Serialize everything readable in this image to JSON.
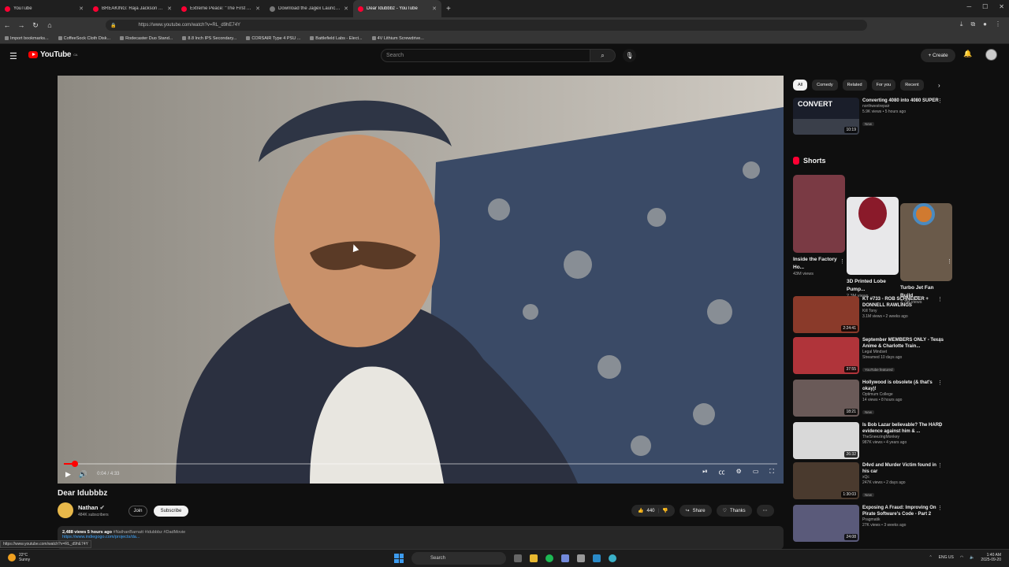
{
  "browser": {
    "tabs": [
      {
        "title": "YouTube",
        "active": false
      },
      {
        "title": "BREAKING: Raja Jackson Arrest...",
        "active": false
      },
      {
        "title": "Extreme Peace: \"The First AI\" St...",
        "active": false
      },
      {
        "title": "Download the Jagex Launcher -",
        "active": false
      },
      {
        "title": "Dear Idubbbz - YouTube",
        "active": true
      }
    ],
    "url": "https://www.youtube.com/watch?v=RL_d9hE74Y",
    "bookmarks": [
      "Import bookmarks...",
      "CoffeeSock Cloth Disk...",
      "Rodecaster Duo Stand...",
      "8.8 Inch IPS Secondary...",
      "CORSAIR Type 4 PSU ...",
      "Battlefield Labs - Elect...",
      "4V Lithium Screwdrive..."
    ]
  },
  "youtube": {
    "logo_text": "YouTube",
    "region": "CA",
    "search_placeholder": "Search",
    "create_label": "Create"
  },
  "player": {
    "time": "0:04 / 4:33",
    "progress_fraction": 0.015
  },
  "video": {
    "title": "Dear Idubbbz",
    "channel": "Nathan",
    "subscribers": "484K subscribers",
    "join_label": "Join",
    "subscribe_label": "Subscribe",
    "likes": "440",
    "share_label": "Share",
    "thanks_label": "Thanks",
    "views_time": "2,488 views  5 hours ago",
    "hashtags": "#NathanBarnatt #idubbbz #DadMovie",
    "desc_link": "https://www.indiegogo.com/projects/da..."
  },
  "status_url": "https://www.youtube.com/watch?v=RL_d9hE74Y",
  "chips": [
    "All",
    "Comedy",
    "Related",
    "For you",
    "Recent"
  ],
  "recommended_top": {
    "title": "Converting 4080 into 4080 SUPER",
    "channel": "northwestrepair",
    "meta": "5.9K views • 5 hours ago",
    "badge": "New",
    "duration": "10:19",
    "thumb_text": "CONVERT"
  },
  "shorts": {
    "heading": "Shorts",
    "items": [
      {
        "title": "Inside the Factory Ho...",
        "views": "43M views"
      },
      {
        "title": "3D Printed Lobe Pump...",
        "views": "2.3M views"
      },
      {
        "title": "Turbo Jet Fan Build ...",
        "views": "2.7M views"
      }
    ]
  },
  "recommended": [
    {
      "title": "KT #733 - ROB SCHNEIDER + DONNELL RAWLINGS",
      "channel": "Kill Tony",
      "meta": "3.1M views • 2 weeks ago",
      "badge": "",
      "duration": "2:24:41",
      "color": "#8a3a2a"
    },
    {
      "title": "September MEMBERS ONLY - Texas Anime & Charlotte Train...",
      "channel": "Legal Mindset",
      "meta": "Streamed 10 days ago",
      "badge": "YouTube featured",
      "duration": "37:55",
      "color": "#b0343a"
    },
    {
      "title": "Hollywood is obsolete (& that's okay)!",
      "channel": "Optimum College",
      "meta": "14 views • 8 hours ago",
      "badge": "New",
      "duration": "18:21",
      "color": "#6a5a58"
    },
    {
      "title": "Is Bob Lazar believable? The HARD evidence against him & ...",
      "channel": "TheSneezingMonkey",
      "meta": "987K views • 4 years ago",
      "badge": "",
      "duration": "26:32",
      "color": "#d9d9d9"
    },
    {
      "title": "D4vd and Murder Victim found in his car",
      "channel": "xQc",
      "meta": "247K views • 2 days ago",
      "badge": "New",
      "duration": "1:30:03",
      "color": "#4a3a2e"
    },
    {
      "title": "Exposing A Fraud: Improving On Pirate Software's Code - Part 2",
      "channel": "Pragmatik",
      "meta": "27K views • 3 weeks ago",
      "badge": "",
      "duration": "24:08",
      "color": "#5a5a7a"
    }
  ],
  "taskbar": {
    "temp": "22°C",
    "weather": "Sunny",
    "search": "Search",
    "lang": "ENG US",
    "time": "1:40 AM",
    "date": "2025-09-20"
  }
}
